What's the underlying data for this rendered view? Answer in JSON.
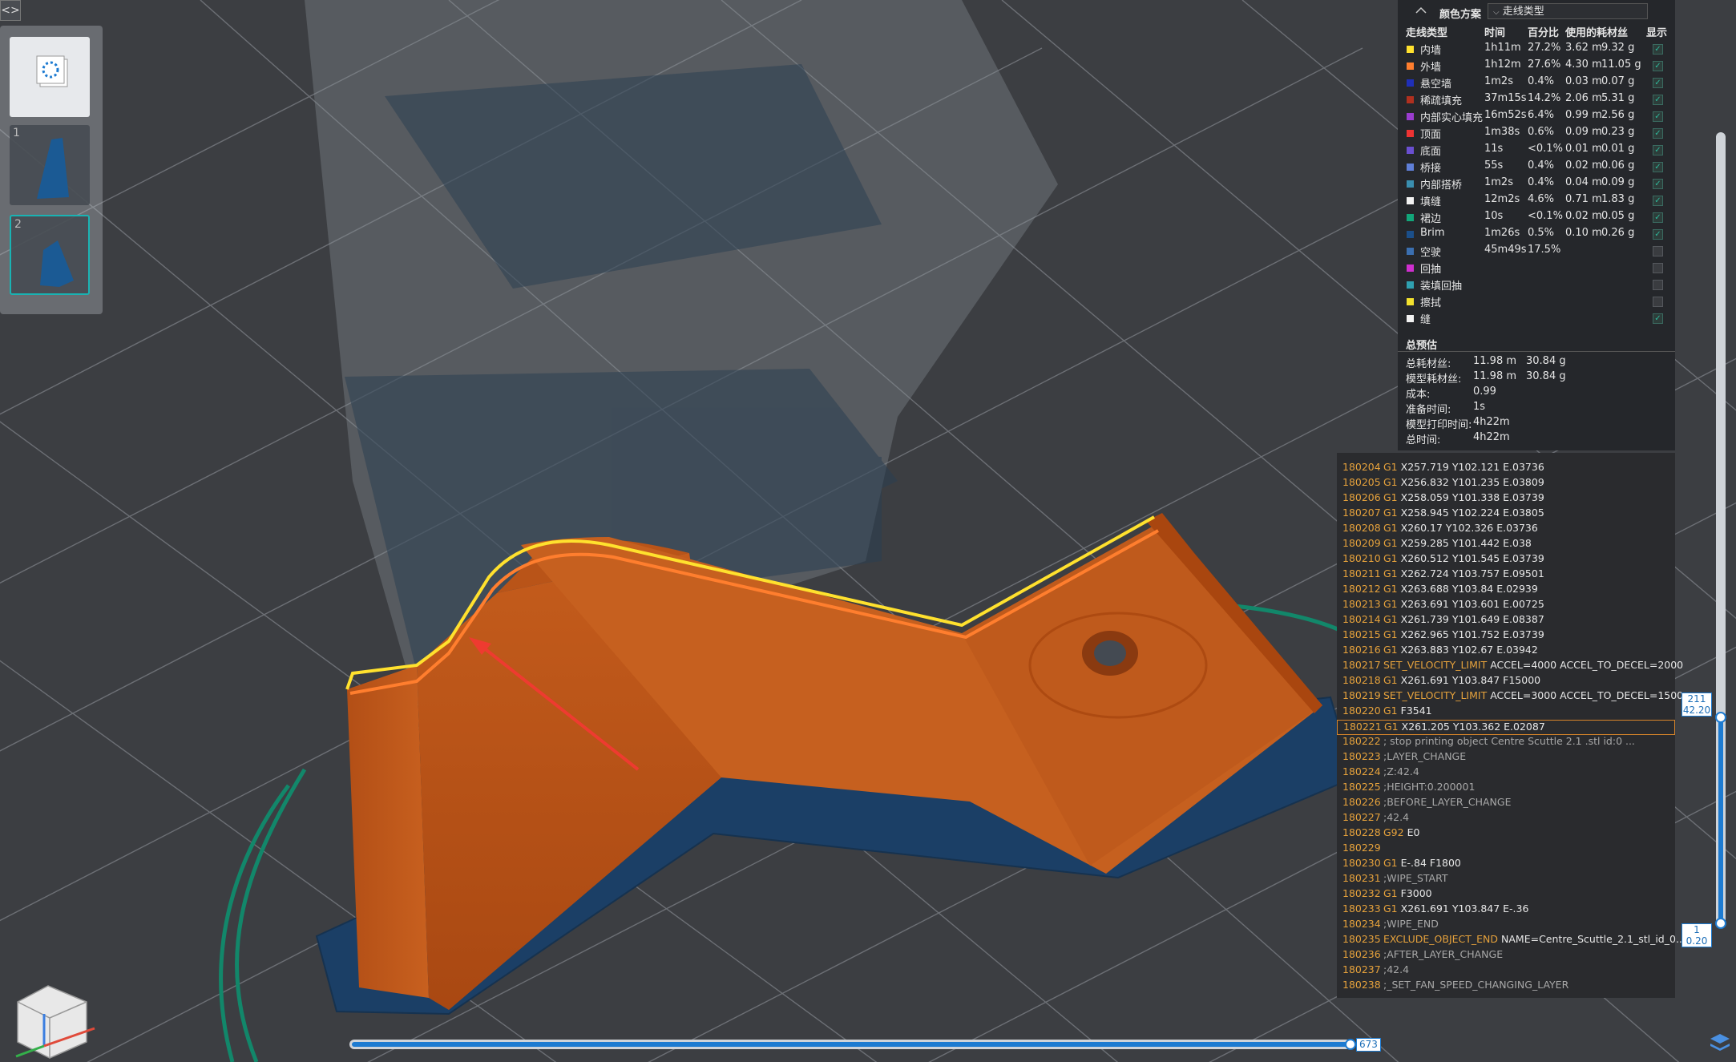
{
  "header": {
    "scheme_title": "颜色方案",
    "scheme_value": "走线类型"
  },
  "columns": {
    "type": "走线类型",
    "time": "时间",
    "percent": "百分比",
    "used": "使用的耗材丝",
    "show": "显示"
  },
  "legend": [
    {
      "name": "内墙",
      "time": "1h11m",
      "percent": "27.2%",
      "length": "3.62 m",
      "weight": "9.32 g",
      "color": "#ffe12e",
      "shown": true
    },
    {
      "name": "外墙",
      "time": "1h12m",
      "percent": "27.6%",
      "length": "4.30 m",
      "weight": "11.05 g",
      "color": "#ff7e2e",
      "shown": true
    },
    {
      "name": "悬空墙",
      "time": "1m2s",
      "percent": "0.4%",
      "length": "0.03 m",
      "weight": "0.07 g",
      "color": "#1f2fb8",
      "shown": true
    },
    {
      "name": "稀疏填充",
      "time": "37m15s",
      "percent": "14.2%",
      "length": "2.06 m",
      "weight": "5.31 g",
      "color": "#b0301f",
      "shown": true
    },
    {
      "name": "内部实心填充",
      "time": "16m52s",
      "percent": "6.4%",
      "length": "0.99 m",
      "weight": "2.56 g",
      "color": "#9a3ccf",
      "shown": true
    },
    {
      "name": "顶面",
      "time": "1m38s",
      "percent": "0.6%",
      "length": "0.09 m",
      "weight": "0.23 g",
      "color": "#ee3333",
      "shown": true
    },
    {
      "name": "底面",
      "time": "11s",
      "percent": "<0.1%",
      "length": "0.01 m",
      "weight": "0.01 g",
      "color": "#6a4fd0",
      "shown": true
    },
    {
      "name": "桥接",
      "time": "55s",
      "percent": "0.4%",
      "length": "0.02 m",
      "weight": "0.06 g",
      "color": "#5f7fd8",
      "shown": true
    },
    {
      "name": "内部搭桥",
      "time": "1m2s",
      "percent": "0.4%",
      "length": "0.04 m",
      "weight": "0.09 g",
      "color": "#3a8fb0",
      "shown": true
    },
    {
      "name": "填缝",
      "time": "12m2s",
      "percent": "4.6%",
      "length": "0.71 m",
      "weight": "1.83 g",
      "color": "#f2f2f2",
      "shown": true
    },
    {
      "name": "裙边",
      "time": "10s",
      "percent": "<0.1%",
      "length": "0.02 m",
      "weight": "0.05 g",
      "color": "#12a67a",
      "shown": true
    },
    {
      "name": "Brim",
      "time": "1m26s",
      "percent": "0.5%",
      "length": "0.10 m",
      "weight": "0.26 g",
      "color": "#1b4f8a",
      "shown": true
    },
    {
      "name": "空驶",
      "time": "45m49s",
      "percent": "17.5%",
      "length": "",
      "weight": "",
      "color": "#3b6fb0",
      "shown": false
    },
    {
      "name": "回抽",
      "time": "",
      "percent": "",
      "length": "",
      "weight": "",
      "color": "#cf2fcf",
      "shown": false
    },
    {
      "name": "装填回抽",
      "time": "",
      "percent": "",
      "length": "",
      "weight": "",
      "color": "#2fa0b0",
      "shown": false
    },
    {
      "name": "擦拭",
      "time": "",
      "percent": "",
      "length": "",
      "weight": "",
      "color": "#f2e12e",
      "shown": false
    },
    {
      "name": "缝",
      "time": "",
      "percent": "",
      "length": "",
      "weight": "",
      "color": "#f2f2f2",
      "shown": true
    }
  ],
  "summary": {
    "title": "总预估",
    "rows": [
      {
        "label": "总耗材丝:",
        "v1": "11.98 m",
        "v2": "30.84 g"
      },
      {
        "label": "模型耗材丝:",
        "v1": "11.98 m",
        "v2": "30.84 g"
      },
      {
        "label": "成本:",
        "v1": "0.99",
        "v2": ""
      },
      {
        "label": "准备时间:",
        "v1": "1s",
        "v2": ""
      },
      {
        "label": "模型打印时间:",
        "v1": "4h22m",
        "v2": ""
      },
      {
        "label": "总时间:",
        "v1": "4h22m",
        "v2": ""
      }
    ]
  },
  "gcode": [
    {
      "n": "180204",
      "cmd": "G1",
      "rest": "X257.719 Y102.121 E.03736"
    },
    {
      "n": "180205",
      "cmd": "G1",
      "rest": "X256.832 Y101.235 E.03809"
    },
    {
      "n": "180206",
      "cmd": "G1",
      "rest": "X258.059 Y101.338 E.03739"
    },
    {
      "n": "180207",
      "cmd": "G1",
      "rest": "X258.945 Y102.224 E.03805"
    },
    {
      "n": "180208",
      "cmd": "G1",
      "rest": "X260.17 Y102.326 E.03736"
    },
    {
      "n": "180209",
      "cmd": "G1",
      "rest": "X259.285 Y101.442 E.038"
    },
    {
      "n": "180210",
      "cmd": "G1",
      "rest": "X260.512 Y101.545 E.03739"
    },
    {
      "n": "180211",
      "cmd": "G1",
      "rest": "X262.724 Y103.757 E.09501"
    },
    {
      "n": "180212",
      "cmd": "G1",
      "rest": "X263.688 Y103.84 E.02939"
    },
    {
      "n": "180213",
      "cmd": "G1",
      "rest": "X263.691 Y103.601 E.00725"
    },
    {
      "n": "180214",
      "cmd": "G1",
      "rest": "X261.739 Y101.649 E.08387"
    },
    {
      "n": "180215",
      "cmd": "G1",
      "rest": "X262.965 Y101.752 E.03739"
    },
    {
      "n": "180216",
      "cmd": "G1",
      "rest": "X263.883 Y102.67 E.03942"
    },
    {
      "n": "180217",
      "cmd": "SET_VELOCITY_LIMIT",
      "rest": "ACCEL=4000 ACCEL_TO_DECEL=2000"
    },
    {
      "n": "180218",
      "cmd": "G1",
      "rest": "X261.691 Y103.847 F15000"
    },
    {
      "n": "180219",
      "cmd": "SET_VELOCITY_LIMIT",
      "rest": "ACCEL=3000 ACCEL_TO_DECEL=1500"
    },
    {
      "n": "180220",
      "cmd": "G1",
      "rest": "F3541"
    },
    {
      "n": "180221",
      "cmd": "G1",
      "rest": "X261.205 Y103.362 E.02087",
      "hl": true
    },
    {
      "n": "180222",
      "comment": "; stop printing object Centre Scuttle 2.1 .stl id:0 ..."
    },
    {
      "n": "180223",
      "comment": ";LAYER_CHANGE"
    },
    {
      "n": "180224",
      "comment": ";Z:42.4"
    },
    {
      "n": "180225",
      "comment": ";HEIGHT:0.200001"
    },
    {
      "n": "180226",
      "comment": ";BEFORE_LAYER_CHANGE"
    },
    {
      "n": "180227",
      "comment": ";42.4"
    },
    {
      "n": "180228",
      "cmd": "G92",
      "rest": "E0"
    },
    {
      "n": "180229",
      "comment": ""
    },
    {
      "n": "180230",
      "cmd": "G1",
      "rest": "E-.84 F1800"
    },
    {
      "n": "180231",
      "comment": ";WIPE_START"
    },
    {
      "n": "180232",
      "cmd": "G1",
      "rest": "F3000"
    },
    {
      "n": "180233",
      "cmd": "G1",
      "rest": "X261.691 Y103.847 E-.36"
    },
    {
      "n": "180234",
      "comment": ";WIPE_END"
    },
    {
      "n": "180235",
      "cmd": "EXCLUDE_OBJECT_END",
      "rest": "NAME=Centre_Scuttle_2.1_stl_id_0..."
    },
    {
      "n": "180236",
      "comment": ";AFTER_LAYER_CHANGE"
    },
    {
      "n": "180237",
      "comment": ";42.4"
    },
    {
      "n": "180238",
      "comment": ";_SET_FAN_SPEED_CHANGING_LAYER"
    }
  ],
  "sliders": {
    "layer_top": "211",
    "height_top": "42.20",
    "layer_bottom": "1",
    "height_bottom": "0.20",
    "horizontal_value": "673"
  },
  "plates": [
    "1",
    "2"
  ],
  "colors": {
    "accent": "#1d7bd1",
    "model": "#c2571a",
    "brim": "#1b3f66",
    "skirt": "#12876a"
  }
}
